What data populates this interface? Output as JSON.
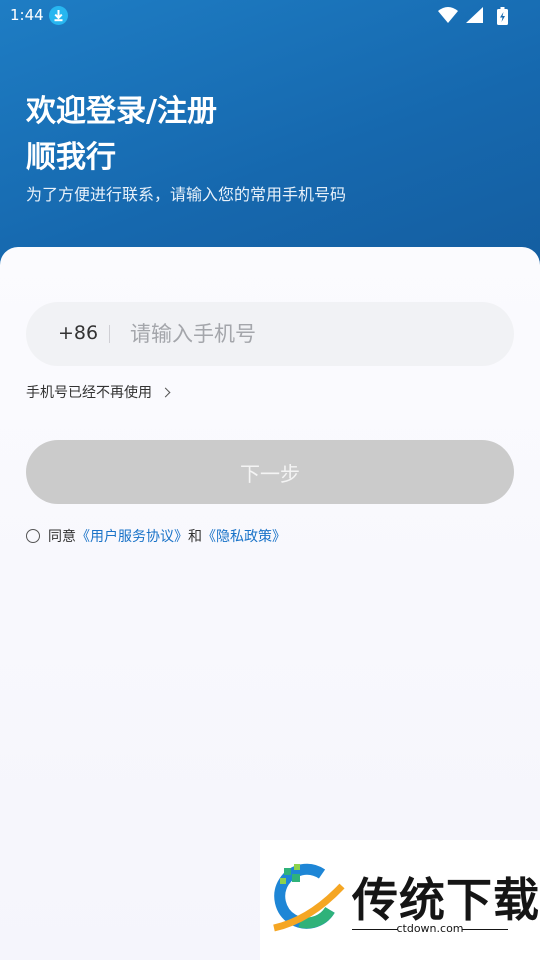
{
  "status_bar": {
    "time": "1:44",
    "icons": [
      "download-icon",
      "wifi-icon",
      "signal-icon",
      "battery-charging-icon"
    ]
  },
  "header": {
    "title_line1": "欢迎登录/注册",
    "title_line2": "顺我行",
    "subtitle": "为了方便进行联系，请输入您的常用手机号码"
  },
  "form": {
    "country_code": "+86",
    "phone_value": "",
    "phone_placeholder": "请输入手机号",
    "no_longer_link": "手机号已经不再使用",
    "next_label": "下一步"
  },
  "agreement": {
    "prefix": "同意",
    "user_agreement": "《用户服务协议》",
    "conjunction": "和",
    "privacy_policy": "《隐私政策》"
  },
  "watermark": {
    "brand": "传统下载",
    "domain": "ctdown.com"
  },
  "colors": {
    "header_blue": "#1668ae",
    "link_blue": "#1a73c8",
    "button_disabled": "#cbcbcb"
  }
}
